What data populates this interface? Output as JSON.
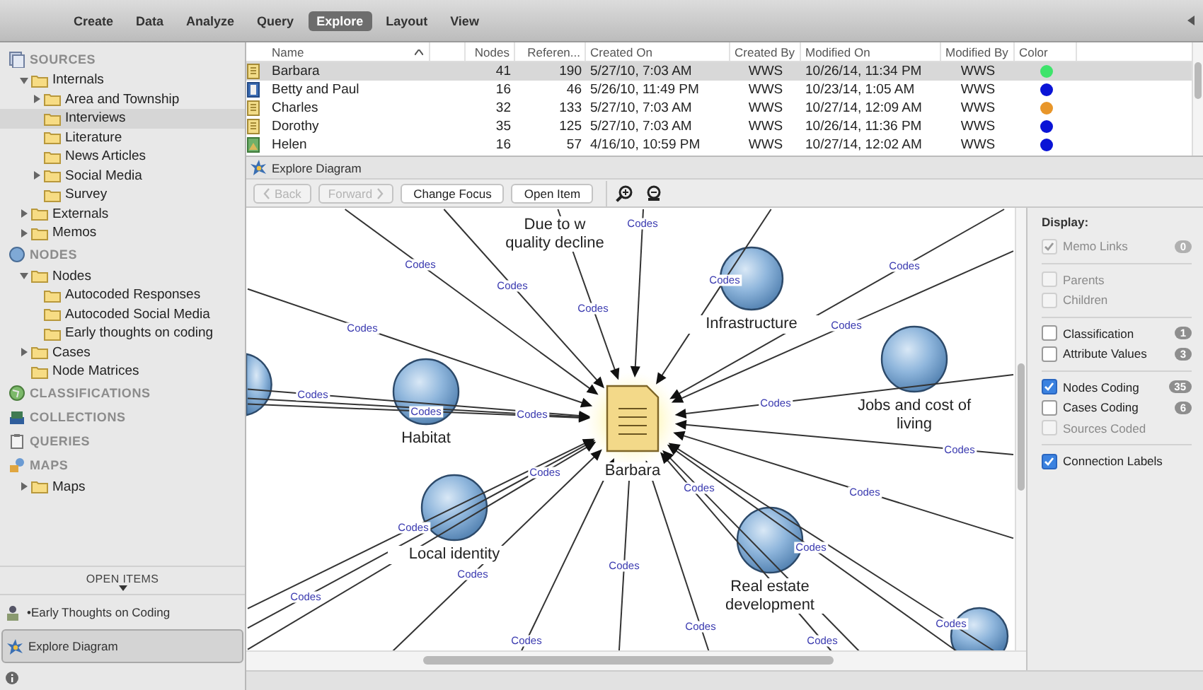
{
  "toolbar": {
    "tabs": [
      {
        "label": "Create",
        "selected": false
      },
      {
        "label": "Data",
        "selected": false
      },
      {
        "label": "Analyze",
        "selected": false
      },
      {
        "label": "Query",
        "selected": false
      },
      {
        "label": "Explore",
        "selected": true
      },
      {
        "label": "Layout",
        "selected": false
      },
      {
        "label": "View",
        "selected": false
      }
    ]
  },
  "navigator": {
    "sections": [
      {
        "label": "SOURCES",
        "items": [
          {
            "label": "Internals",
            "expanded": true,
            "selected": false,
            "children": [
              {
                "label": "Area and Township",
                "expanded": false,
                "selected": false
              },
              {
                "label": "Interviews",
                "selected": true
              },
              {
                "label": "Literature",
                "selected": false
              },
              {
                "label": "News Articles",
                "selected": false
              },
              {
                "label": "Social Media",
                "expanded": false,
                "selected": false
              },
              {
                "label": "Survey",
                "selected": false
              }
            ]
          },
          {
            "label": "Externals",
            "expanded": false,
            "selected": false
          },
          {
            "label": "Memos",
            "expanded": false,
            "selected": false
          }
        ]
      },
      {
        "label": "NODES",
        "items": [
          {
            "label": "Nodes",
            "expanded": true,
            "selected": false,
            "children": [
              {
                "label": "Autocoded Responses",
                "selected": false
              },
              {
                "label": "Autocoded Social Media",
                "selected": false
              },
              {
                "label": "Early thoughts on coding",
                "selected": false
              }
            ]
          },
          {
            "label": "Cases",
            "expanded": false,
            "selected": false
          },
          {
            "label": "Node Matrices",
            "selected": false
          }
        ]
      },
      {
        "label": "CLASSIFICATIONS"
      },
      {
        "label": "COLLECTIONS"
      },
      {
        "label": "QUERIES"
      },
      {
        "label": "MAPS",
        "items": [
          {
            "label": "Maps",
            "expanded": false,
            "selected": false
          }
        ]
      }
    ]
  },
  "open_items": {
    "title": "OPEN ITEMS",
    "items": [
      {
        "label": "•Early Thoughts on Coding",
        "selected": false
      },
      {
        "label": "Explore Diagram",
        "selected": true
      }
    ]
  },
  "table": {
    "columns": [
      "Name",
      "Nodes",
      "Referen...",
      "Created On",
      "Created By",
      "Modified On",
      "Modified By",
      "Color"
    ],
    "rows": [
      {
        "kind": "document",
        "selected": true,
        "cells": [
          "Barbara",
          "41",
          "190",
          "5/27/10, 7:03 AM",
          "WWS",
          "10/26/14, 11:34 PM",
          "WWS"
        ],
        "color": "#3ee46b"
      },
      {
        "kind": "audio",
        "selected": false,
        "cells": [
          "Betty and Paul",
          "16",
          "46",
          "5/26/10, 11:49 PM",
          "WWS",
          "10/23/14, 1:05 AM",
          "WWS"
        ],
        "color": "#0a14d6"
      },
      {
        "kind": "document",
        "selected": false,
        "cells": [
          "Charles",
          "32",
          "133",
          "5/27/10, 7:03 AM",
          "WWS",
          "10/27/14, 12:09 AM",
          "WWS"
        ],
        "color": "#e8962a"
      },
      {
        "kind": "document",
        "selected": false,
        "cells": [
          "Dorothy",
          "35",
          "125",
          "5/27/10, 7:03 AM",
          "WWS",
          "10/26/14, 11:36 PM",
          "WWS"
        ],
        "color": "#0a14d6"
      },
      {
        "kind": "picture",
        "selected": false,
        "cells": [
          "Helen",
          "16",
          "57",
          "4/16/10, 10:59 PM",
          "WWS",
          "10/27/14, 12:02 AM",
          "WWS"
        ],
        "color": "#0a14d6"
      }
    ]
  },
  "explore": {
    "title": "Explore Diagram",
    "buttons": [
      {
        "label": "Back",
        "kind": "back",
        "disabled": true
      },
      {
        "label": "Forward",
        "kind": "forward",
        "disabled": true
      },
      {
        "label": "Change Focus",
        "kind": "plain",
        "disabled": false
      },
      {
        "label": "Open Item",
        "kind": "plain",
        "disabled": false
      }
    ]
  },
  "diagram": {
    "focus": {
      "label": "Barbara"
    },
    "nodes": [
      {
        "kind": "text",
        "lines": [
          "Due to w",
          "quality decline"
        ]
      },
      {
        "kind": "sphere",
        "label": "Infrastructure"
      },
      {
        "kind": "sphere",
        "label": "Jobs and cost of living"
      },
      {
        "kind": "sphere",
        "label": "Habitat"
      },
      {
        "kind": "sphere",
        "label": "Local identity"
      },
      {
        "kind": "sphere",
        "label": "Real estate development"
      },
      {
        "kind": "sphere"
      },
      {
        "kind": "sphere"
      }
    ],
    "connections": [
      {
        "label": "Codes"
      },
      {
        "label": "Codes"
      },
      {
        "label": "Codes"
      },
      {
        "label": "Codes"
      },
      {
        "label": "Codes"
      },
      {
        "label": "Codes"
      },
      {
        "label": "Codes"
      },
      {
        "label": "Codes"
      },
      {
        "label": "Codes"
      },
      {
        "label": "Codes"
      },
      {
        "label": "Codes"
      },
      {
        "label": "Codes"
      },
      {
        "label": "Codes"
      },
      {
        "label": "Codes"
      },
      {
        "label": "Codes"
      },
      {
        "label": "Codes"
      },
      {
        "label": "Codes"
      },
      {
        "label": "Codes"
      },
      {
        "label": "Codes"
      },
      {
        "label": "Codes"
      },
      {
        "label": "Codes"
      },
      {
        "label": "Codes"
      },
      {
        "label": "Codes"
      },
      {
        "label": "Codes"
      },
      {
        "label": "Codes"
      }
    ]
  },
  "display": {
    "title": "Display:",
    "groups": [
      {
        "items": [
          {
            "label": "Memo Links",
            "checked": true,
            "disabled": true,
            "count": "0"
          }
        ]
      },
      {
        "items": [
          {
            "label": "Parents",
            "checked": false,
            "disabled": true
          },
          {
            "label": "Children",
            "checked": false,
            "disabled": true
          }
        ]
      },
      {
        "items": [
          {
            "label": "Classification",
            "checked": false,
            "disabled": false,
            "count": "1"
          },
          {
            "label": "Attribute Values",
            "checked": false,
            "disabled": false,
            "count": "3"
          }
        ]
      },
      {
        "items": [
          {
            "label": "Nodes Coding",
            "checked": true,
            "disabled": false,
            "count": "35"
          },
          {
            "label": "Cases Coding",
            "checked": false,
            "disabled": false,
            "count": "6"
          },
          {
            "label": "Sources Coded",
            "checked": false,
            "disabled": true
          }
        ]
      },
      {
        "items": [
          {
            "label": "Connection Labels",
            "checked": true,
            "disabled": false
          }
        ]
      }
    ]
  }
}
